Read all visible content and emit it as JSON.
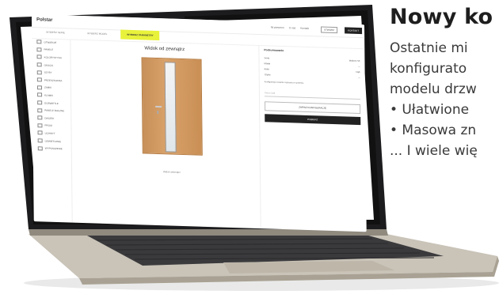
{
  "promo": {
    "title": "Nowy ko",
    "lines": [
      "Ostatnie mi",
      "konfigurato",
      "modelu drzw"
    ],
    "bullets": [
      "• Ułatwione",
      "• Masowa zn",
      "... I wiele wię"
    ]
  },
  "ui": {
    "logo": "Polstar",
    "top_links": [
      "Mi parceron",
      "O nas",
      "Kontakt"
    ],
    "top_button_outline": "STWÓRZ",
    "top_button_dark": "KONTAKT",
    "steps": [
      "WYBIERZ SERIĘ",
      "WYBIERZ MODEL",
      "WYBIERZ PARAMETRY"
    ],
    "sidebar": [
      "OTWARCIE",
      "PANELE",
      "KOLORYSTYKA",
      "OKUCIA",
      "SZYBY",
      "PRZESZKLENIA",
      "ZAMKI",
      "KLAMKI",
      "DOŚWIETLE",
      "PANELE BOCZNE",
      "DASZEK",
      "PROGI",
      "UCHWYT",
      "OŚWIETLENIE",
      "WYPOSAŻENIE"
    ],
    "canvas_title": "Widok od zewnątrz",
    "preview_link": "Widok wewnątrz",
    "panel": {
      "title": "Podsumowanie",
      "rows": [
        [
          "Seria",
          "Modern S5"
        ],
        [
          "Model",
          "—"
        ],
        [
          "Kolor",
          "Dąb"
        ],
        [
          "Szyba",
          "—"
        ]
      ],
      "note": "Konfiguracja zostanie zapisana w systemie.",
      "input_placeholder": "Twój e-mail",
      "button_outline": "ZAPISZ KONFIGURACJĘ",
      "button_dark": "POBIERZ"
    }
  }
}
